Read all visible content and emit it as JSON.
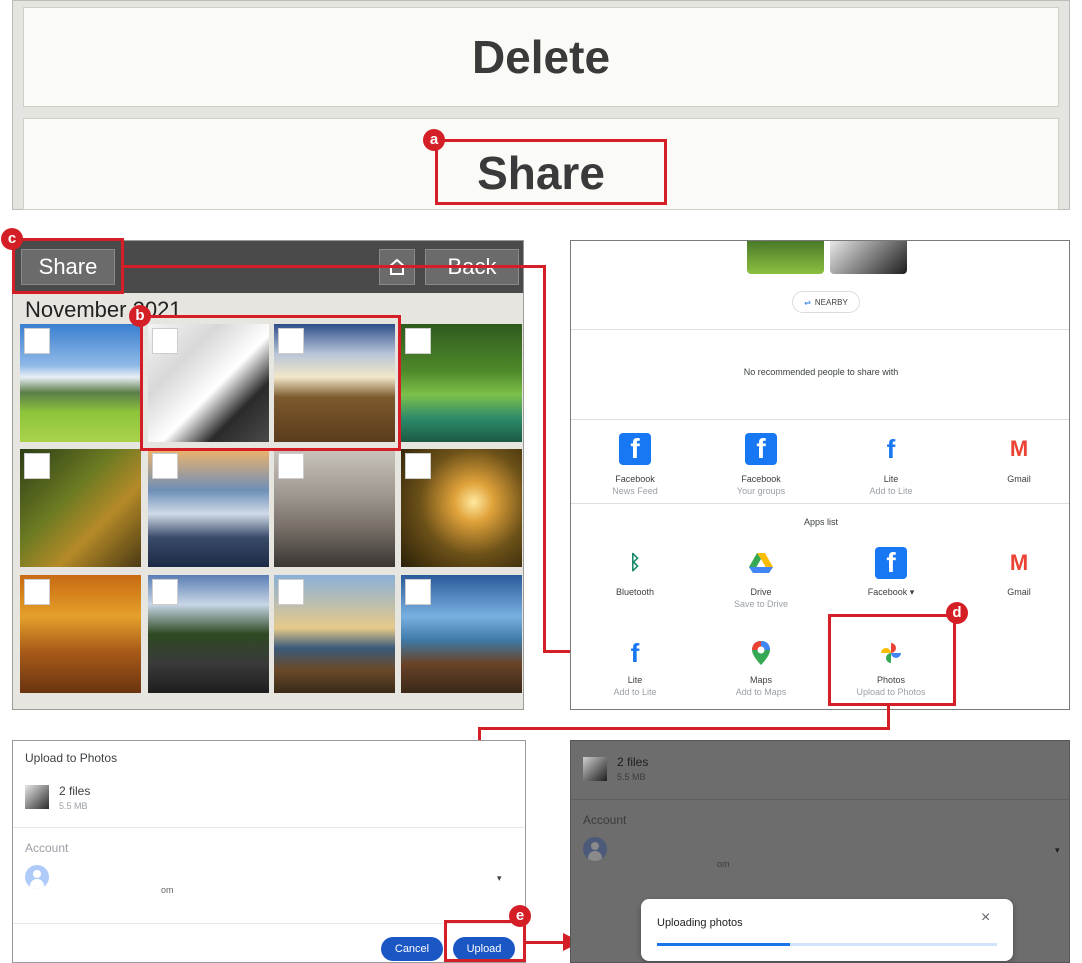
{
  "top": {
    "delete_label": "Delete",
    "share_label": "Share"
  },
  "callouts": {
    "a": "a",
    "b": "b",
    "c": "c",
    "d": "d",
    "e": "e"
  },
  "gallery": {
    "share_label": "Share",
    "home_icon": "home-icon",
    "back_label": "Back",
    "month": "November 2021",
    "photos": [
      "Mountain meadow",
      "Snowy forest road",
      "Hillside building",
      "Lake with trees",
      "Autumn woodland path",
      "Snowy mountain range",
      "Rocky shoreline",
      "Sunlit forest",
      "Autumn forest cabin",
      "Forest highway",
      "Lake sunset tree",
      "Bench by lake"
    ]
  },
  "share_sheet": {
    "nearby_label": "NEARBY",
    "no_people": "No recommended people to share with",
    "recommended": [
      {
        "icon": "facebook-icon",
        "name": "Facebook",
        "sub": "News Feed"
      },
      {
        "icon": "facebook-icon",
        "name": "Facebook",
        "sub": "Your groups"
      },
      {
        "icon": "facebook-lite-icon",
        "name": "Lite",
        "sub": "Add to Lite"
      },
      {
        "icon": "gmail-icon",
        "name": "Gmail",
        "sub": ""
      }
    ],
    "apps_list_label": "Apps list",
    "apps": [
      {
        "icon": "bluetooth-icon",
        "name": "Bluetooth",
        "sub": ""
      },
      {
        "icon": "drive-icon",
        "name": "Drive",
        "sub": "Save to Drive"
      },
      {
        "icon": "facebook-icon",
        "name": "Facebook",
        "sub": ""
      },
      {
        "icon": "gmail-icon",
        "name": "Gmail",
        "sub": ""
      },
      {
        "icon": "facebook-lite-icon",
        "name": "Lite",
        "sub": "Add to Lite"
      },
      {
        "icon": "maps-icon",
        "name": "Maps",
        "sub": "Add to Maps"
      },
      {
        "icon": "photos-icon",
        "name": "Photos",
        "sub": "Upload to Photos"
      }
    ]
  },
  "upload_dialog": {
    "title": "Upload to Photos",
    "files": "2 files",
    "size": "5.5 MB",
    "account_label": "Account",
    "account_suffix": "om",
    "cancel_label": "Cancel",
    "upload_label": "Upload"
  },
  "uploading": {
    "files": "2 files",
    "size": "5.5 MB",
    "account_label": "Account",
    "account_suffix": "om",
    "toast_text": "Uploading photos",
    "progress": 0.39
  },
  "colors": {
    "callout_red": "#d41f26",
    "google_blue": "#1a56c4"
  }
}
